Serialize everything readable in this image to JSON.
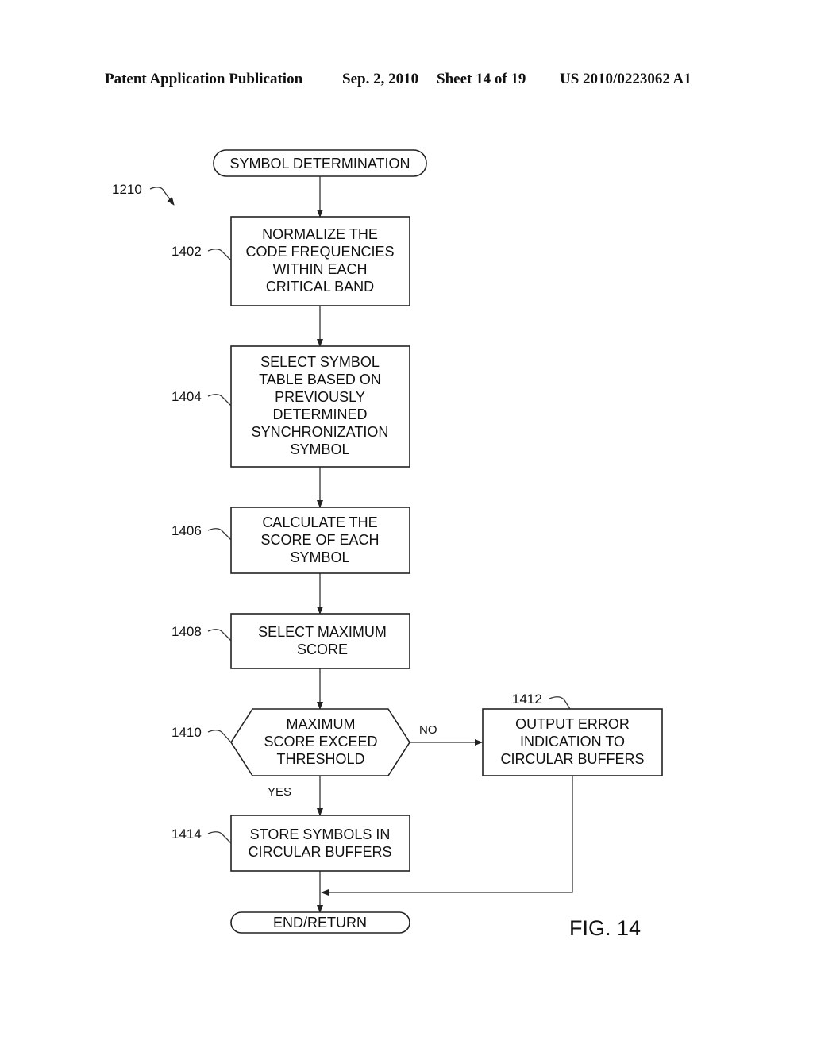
{
  "header": {
    "publication": "Patent Application Publication",
    "date": "Sep. 2, 2010",
    "sheet": "Sheet 14 of 19",
    "number": "US 2010/0223062 A1"
  },
  "diagram": {
    "ref": "1210",
    "start": "SYMBOL DETERMINATION",
    "steps": [
      {
        "id": "1402",
        "lines": [
          "NORMALIZE THE",
          "CODE FREQUENCIES",
          "WITHIN EACH",
          "CRITICAL BAND"
        ]
      },
      {
        "id": "1404",
        "lines": [
          "SELECT SYMBOL",
          "TABLE BASED ON",
          "PREVIOUSLY",
          "DETERMINED",
          "SYNCHRONIZATION",
          "SYMBOL"
        ]
      },
      {
        "id": "1406",
        "lines": [
          "CALCULATE THE",
          "SCORE OF EACH",
          "SYMBOL"
        ]
      },
      {
        "id": "1408",
        "lines": [
          "SELECT MAXIMUM",
          "SCORE"
        ]
      },
      {
        "id": "1410",
        "lines": [
          "MAXIMUM",
          "SCORE EXCEED",
          "THRESHOLD"
        ]
      },
      {
        "id": "1412",
        "lines": [
          "OUTPUT ERROR",
          "INDICATION TO",
          "CIRCULAR BUFFERS"
        ]
      },
      {
        "id": "1414",
        "lines": [
          "STORE SYMBOLS IN",
          "CIRCULAR BUFFERS"
        ]
      }
    ],
    "yes_label": "YES",
    "no_label": "NO",
    "end": "END/RETURN",
    "figure_label": "FIG. 14"
  }
}
